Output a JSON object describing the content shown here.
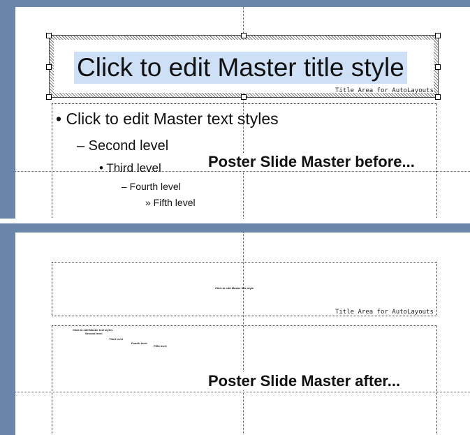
{
  "before": {
    "title_placeholder": "Click to edit Master title style",
    "title_area_label": "Title Area for AutoLayouts",
    "body": {
      "level1": "• Click to edit Master text styles",
      "level2": "– Second level",
      "level3": "• Third level",
      "level4": "– Fourth level",
      "level5": "» Fifth level"
    },
    "caption": "Poster Slide Master before..."
  },
  "after": {
    "title_placeholder": "Click to edit Master title style",
    "title_area_label": "Title Area for AutoLayouts",
    "body": {
      "level1": "Click to edit Master text styles",
      "level2": "Second level",
      "level3": "Third level",
      "level4": "Fourth level",
      "level5": "Fifth level"
    },
    "caption": "Poster Slide Master after..."
  },
  "colors": {
    "frame": "#6a86a8",
    "title_highlight": "#cde0f5"
  }
}
